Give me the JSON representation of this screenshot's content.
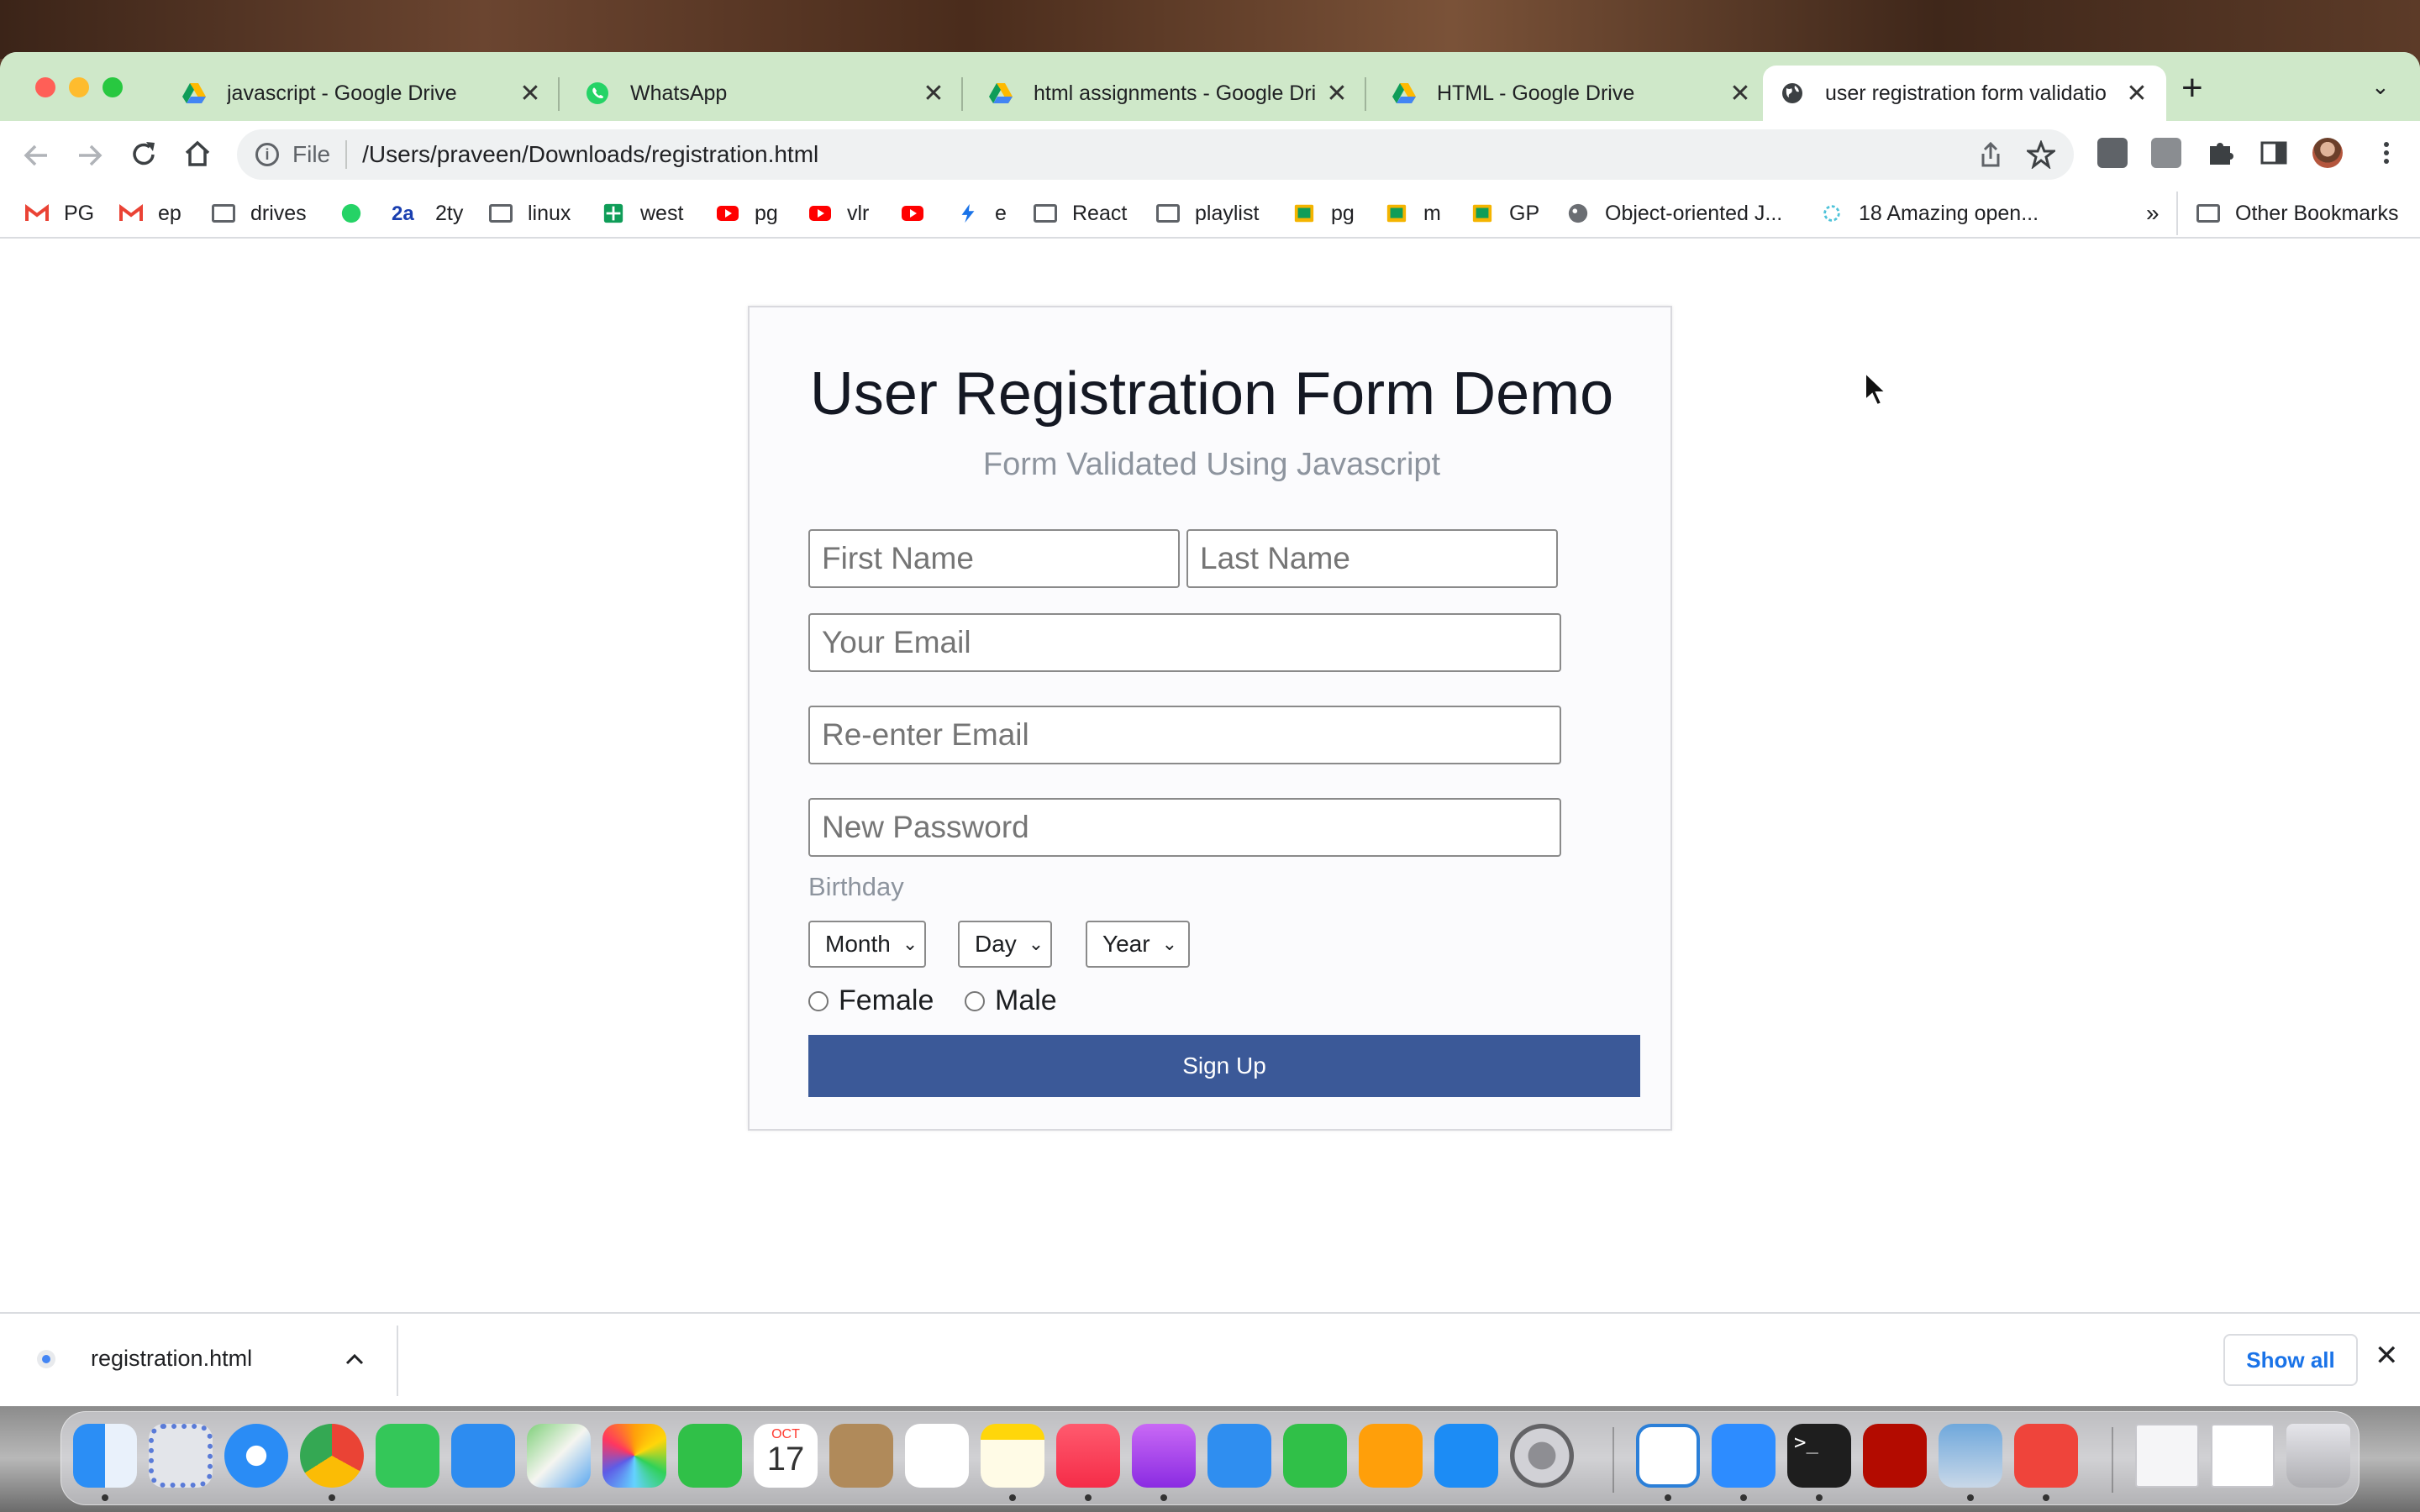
{
  "browser": {
    "tabs": [
      {
        "title": "javascript - Google Drive",
        "icon": "google-drive-icon"
      },
      {
        "title": "WhatsApp",
        "icon": "whatsapp-icon"
      },
      {
        "title": "html assignments - Google Dri",
        "icon": "google-drive-icon"
      },
      {
        "title": "HTML - Google Drive",
        "icon": "google-drive-icon"
      },
      {
        "title": "user registration form validatio",
        "icon": "globe-icon",
        "active": true
      }
    ],
    "new_tab": "+",
    "tab_list": "⌄",
    "close_glyph": "✕",
    "address": {
      "scheme": "File",
      "url": "/Users/praveen/Downloads/registration.html"
    },
    "bookmarks": [
      {
        "label": "PG",
        "icon": "gmail-icon"
      },
      {
        "label": "ep",
        "icon": "gmail-icon"
      },
      {
        "label": "drives",
        "icon": "folder-icon"
      },
      {
        "label": "",
        "icon": "whatsapp-icon"
      },
      {
        "label": "2ty",
        "icon": "2a-icon",
        "icon_text": "2a"
      },
      {
        "label": "linux",
        "icon": "folder-icon"
      },
      {
        "label": "west",
        "icon": "sheets-icon"
      },
      {
        "label": "pg",
        "icon": "youtube-icon"
      },
      {
        "label": "vlr",
        "icon": "youtube-icon"
      },
      {
        "label": "",
        "icon": "youtube-icon"
      },
      {
        "label": "e",
        "icon": "bolt-icon"
      },
      {
        "label": "React",
        "icon": "folder-icon"
      },
      {
        "label": "playlist",
        "icon": "folder-icon"
      },
      {
        "label": "pg",
        "icon": "classroom-icon"
      },
      {
        "label": "m",
        "icon": "classroom-icon"
      },
      {
        "label": "GP",
        "icon": "classroom-icon"
      },
      {
        "label": "Object-oriented J...",
        "icon": "bird-icon"
      },
      {
        "label": "18 Amazing open...",
        "icon": "spinner-icon"
      }
    ],
    "bookmarks_overflow": "»",
    "other_bookmarks": "Other Bookmarks"
  },
  "form": {
    "title": "User Registration Form Demo",
    "subtitle": "Form Validated Using Javascript",
    "first_name_placeholder": "First Name",
    "last_name_placeholder": "Last Name",
    "email_placeholder": "Your Email",
    "reenter_email_placeholder": "Re-enter Email",
    "password_placeholder": "New Password",
    "birthday_label": "Birthday",
    "month_select": "Month",
    "day_select": "Day",
    "year_select": "Year",
    "gender_female": "Female",
    "gender_male": "Male",
    "signup_label": "Sign Up",
    "signup_color": "#3b5998"
  },
  "downloads": {
    "file_name": "registration.html",
    "show_all_label": "Show all",
    "close_glyph": "✕"
  },
  "dock": {
    "apps": [
      "finder-icon",
      "launchpad-icon",
      "safari-icon",
      "chrome-icon",
      "messages-icon",
      "mail-icon",
      "maps-icon",
      "photos-icon",
      "facetime-icon",
      "calendar-icon",
      "contacts-icon",
      "reminders-icon",
      "notes-icon",
      "music-icon",
      "podcasts-icon",
      "keynote-icon",
      "numbers-icon",
      "pages-icon",
      "app-store-icon",
      "system-preferences-icon",
      "vscode-icon",
      "zoom-icon",
      "terminal-icon",
      "acrobat-icon",
      "preview-icon",
      "anydesk-icon",
      "html-file-icon",
      "document-icon",
      "trash-icon"
    ],
    "calendar_month": "OCT",
    "calendar_day": "17"
  },
  "colors": {
    "tab_strip": "#cfe8c9",
    "accent_blue": "#1a73e8"
  }
}
